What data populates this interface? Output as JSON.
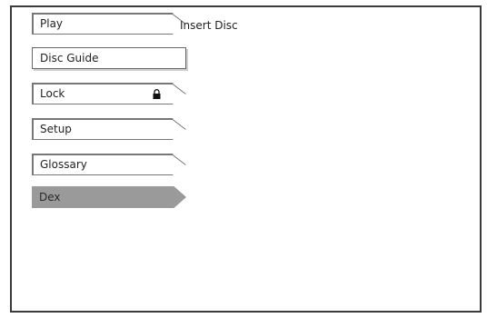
{
  "menu": {
    "items": [
      {
        "label": "Play",
        "icon": ""
      },
      {
        "label": "Disc Guide",
        "icon": ""
      },
      {
        "label": "Lock",
        "icon": "lock-icon"
      },
      {
        "label": "Setup",
        "icon": ""
      },
      {
        "label": "Glossary",
        "icon": ""
      },
      {
        "label": "Dex",
        "icon": ""
      }
    ],
    "selected_index": 5
  },
  "status": {
    "text": "Insert Disc"
  },
  "colors": {
    "border": "#3a3a3a",
    "selected_bg": "#9a9a9a",
    "background": "#ffffff"
  }
}
